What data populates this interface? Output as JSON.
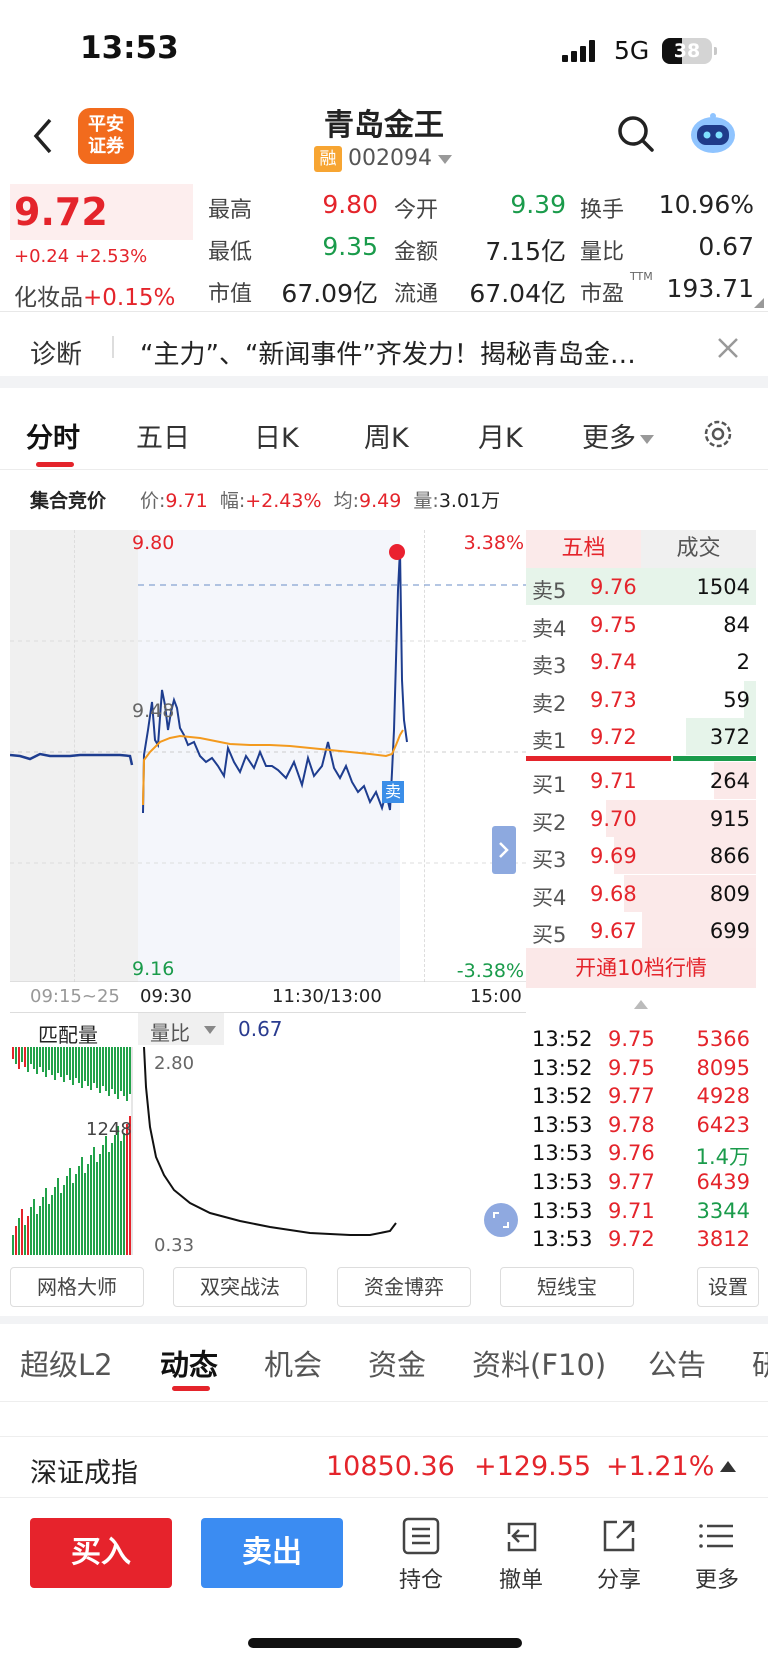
{
  "status": {
    "time": "13:53",
    "network": "5G",
    "battery": "38"
  },
  "header": {
    "logo_line1": "平安",
    "logo_line2": "证券",
    "stock_name": "青岛金王",
    "margin_badge": "融",
    "code": "002094"
  },
  "quote": {
    "price": "9.72",
    "change": "+0.24",
    "change_pct": "+2.53%",
    "sector_label": "化妆品",
    "sector_pct": "+0.15%",
    "high_label": "最高",
    "high": "9.80",
    "low_label": "最低",
    "low": "9.35",
    "mcap_label": "市值",
    "mcap": "67.09亿",
    "open_label": "今开",
    "open": "9.39",
    "amount_label": "金额",
    "amount": "7.15亿",
    "float_label": "流通",
    "float": "67.04亿",
    "turnover_label": "换手",
    "turnover": "10.96%",
    "volratio_label": "量比",
    "volratio": "0.67",
    "pe_label": "市盈",
    "pe_sup": "TTM",
    "pe": "193.71"
  },
  "diagnosis": {
    "label": "诊断",
    "text": "“主力”、“新闻事件”齐发力！揭秘青岛金…"
  },
  "tabs": [
    "分时",
    "五日",
    "日K",
    "周K",
    "月K",
    "更多"
  ],
  "auction": {
    "label": "集合竞价",
    "price_label": "价:",
    "price": "9.71",
    "range_label": "幅:",
    "range": "+2.43%",
    "avg_label": "均:",
    "avg": "9.49",
    "vol_label": "量:",
    "vol": "3.01万"
  },
  "chart": {
    "top_price": "9.80",
    "top_pct": "3.38%",
    "bottom_price": "9.16",
    "bottom_pct": "-3.38%",
    "mid_price": "9.48",
    "sell_marker": "卖",
    "time_labels": [
      "09:15~25",
      "09:30",
      "11:30/13:00",
      "15:00"
    ],
    "sub_label": "匹配量",
    "sub_indicator": "量比",
    "sub_value": "0.67",
    "sub_top": "2.80",
    "sub_bottom": "0.33",
    "sub_mid": "1248"
  },
  "book": {
    "tab_five": "五档",
    "tab_trades": "成交",
    "asks": [
      {
        "label": "卖5",
        "price": "9.76",
        "vol": "1504"
      },
      {
        "label": "卖4",
        "price": "9.75",
        "vol": "84"
      },
      {
        "label": "卖3",
        "price": "9.74",
        "vol": "2"
      },
      {
        "label": "卖2",
        "price": "9.73",
        "vol": "59"
      },
      {
        "label": "卖1",
        "price": "9.72",
        "vol": "372"
      }
    ],
    "bids": [
      {
        "label": "买1",
        "price": "9.71",
        "vol": "264"
      },
      {
        "label": "买2",
        "price": "9.70",
        "vol": "915"
      },
      {
        "label": "买3",
        "price": "9.69",
        "vol": "866"
      },
      {
        "label": "买4",
        "price": "9.68",
        "vol": "809"
      },
      {
        "label": "买5",
        "price": "9.67",
        "vol": "699"
      }
    ],
    "open10": "开通10档行情",
    "trades": [
      {
        "t": "13:52",
        "p": "9.75",
        "v": "5366"
      },
      {
        "t": "13:52",
        "p": "9.75",
        "v": "8095"
      },
      {
        "t": "13:52",
        "p": "9.77",
        "v": "4928"
      },
      {
        "t": "13:53",
        "p": "9.78",
        "v": "6423"
      },
      {
        "t": "13:53",
        "p": "9.76",
        "v": "1.4万"
      },
      {
        "t": "13:53",
        "p": "9.77",
        "v": "6439"
      },
      {
        "t": "13:53",
        "p": "9.71",
        "v": "3344"
      },
      {
        "t": "13:53",
        "p": "9.72",
        "v": "3812"
      }
    ]
  },
  "tools": [
    "网格大师",
    "双突战法",
    "资金博弈",
    "短线宝",
    "设置"
  ],
  "f10_tabs": [
    "超级L2",
    "动态",
    "机会",
    "资金",
    "资料(F10)",
    "公告",
    "研"
  ],
  "index": {
    "name": "深证成指",
    "value": "10850.36",
    "change": "+129.55",
    "pct": "+1.21%"
  },
  "bottom": {
    "buy": "买入",
    "sell": "卖出",
    "actions": [
      "持仓",
      "撤单",
      "分享",
      "更多"
    ]
  }
}
